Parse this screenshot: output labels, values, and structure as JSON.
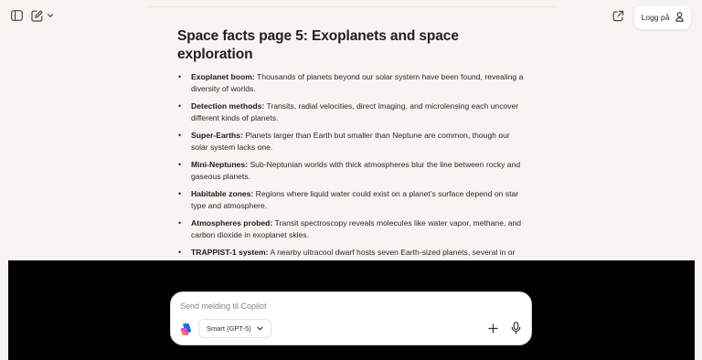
{
  "header": {
    "login_label": "Logg på",
    "icons": [
      "sidebar-toggle-icon",
      "new-chat-icon",
      "chevron-down-icon",
      "share-icon",
      "user-icon"
    ]
  },
  "main": {
    "title": "Space facts page 5: Exoplanets and space exploration",
    "facts": [
      {
        "term": "Exoplanet boom:",
        "text": " Thousands of planets beyond our solar system have been found, revealing a diversity of worlds."
      },
      {
        "term": "Detection methods:",
        "text": " Transits, radial velocities, direct imaging, and microlensing each uncover different kinds of planets."
      },
      {
        "term": "Super-Earths:",
        "text": " Planets larger than Earth but smaller than Neptune are common, though our solar system lacks one."
      },
      {
        "term": "Mini-Neptunes:",
        "text": " Sub-Neptunian worlds with thick atmospheres blur the line between rocky and gaseous planets."
      },
      {
        "term": "Habitable zones:",
        "text": " Regions where liquid water could exist on a planet’s surface depend on star type and atmosphere."
      },
      {
        "term": "Atmospheres probed:",
        "text": " Transit spectroscopy reveals molecules like water vapor, methane, and carbon dioxide in exoplanet skies."
      },
      {
        "term": "TRAPPIST-1 system:",
        "text": " A nearby ultracool dwarf hosts seven Earth-sized planets, several in or near the habitable zone."
      }
    ]
  },
  "composer": {
    "placeholder": "Send melding til Copilot",
    "value": "",
    "model_label": "Smart (GPT-5)",
    "icons": [
      "copilot-logo-icon",
      "chevron-down-icon",
      "plus-icon",
      "microphone-icon"
    ]
  },
  "colors": {
    "background": "#f7f4f1",
    "panel": "#000000",
    "text": "#2b2622"
  }
}
